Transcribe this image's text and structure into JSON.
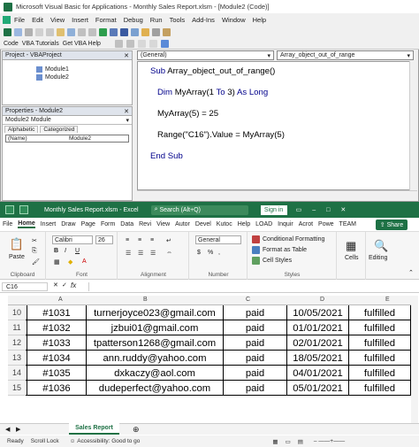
{
  "vba": {
    "title": "Microsoft Visual Basic for Applications - Monthly Sales Report.xlsm - [Module2 (Code)]",
    "menu": [
      "File",
      "Edit",
      "View",
      "Insert",
      "Format",
      "Debug",
      "Run",
      "Tools",
      "Add-Ins",
      "Window",
      "Help"
    ],
    "toolbar": {
      "code": "Code",
      "vba_tutorials": "VBA Tutorials",
      "get_help": "Get VBA Help"
    },
    "project_title": "Project - VBAProject",
    "tree": [
      "Module1",
      "Module2"
    ],
    "properties_title": "Properties - Module2",
    "object_name": "Module2",
    "object_type": "Module",
    "prop_tabs": [
      "Alphabetic",
      "Categorized"
    ],
    "prop_row": {
      "name": "(Name)",
      "value": "Module2"
    },
    "object_dropdown": "(General)",
    "proc_dropdown": "Array_object_out_of_range",
    "code": {
      "l1_kw": "Sub",
      "l1_rest": " Array_object_out_of_range()",
      "l2_kw1": "Dim",
      "l2_mid": " MyArray(1 ",
      "l2_kw2": "To",
      "l2_mid2": " 3) ",
      "l2_kw3": "As Long",
      "l3": "MyArray(5) = 25",
      "l4": "Range(\"C16\").Value = MyArray(5)",
      "l5": "End Sub"
    }
  },
  "excel": {
    "title": "Monthly Sales Report.xlsm  -  Excel",
    "search": "Search (Alt+Q)",
    "signin": "Sign in",
    "tabs": [
      "File",
      "Home",
      "Insert",
      "Draw",
      "Page",
      "Form",
      "Data",
      "Revi",
      "View",
      "Autor",
      "Devel",
      "Kutoc",
      "Help",
      "LOAD",
      "Inquir",
      "Acrot",
      "Powe",
      "TEAM"
    ],
    "share": "Share",
    "font_name": "Calibri",
    "font_size": "26",
    "number_format": "General",
    "ribbon": {
      "paste": "Paste",
      "clipboard": "Clipboard",
      "font": "Font",
      "alignment": "Alignment",
      "number": "Number",
      "styles": "Styles",
      "conditional": "Conditional Formatting",
      "format_table": "Format as Table",
      "cell_styles": "Cell Styles",
      "cells": "Cells",
      "editing": "Editing"
    },
    "name_box": "C16",
    "fx": "fx",
    "columns": [
      "A",
      "B",
      "C",
      "D",
      "E"
    ],
    "rows": [
      {
        "num": "10",
        "id": "#1031",
        "email": "turnerjoyce023@gmail.com",
        "status": "paid",
        "date": "10/05/2021",
        "fulfil": "fulfilled"
      },
      {
        "num": "11",
        "id": "#1032",
        "email": "jzbui01@gmail.com",
        "status": "paid",
        "date": "01/01/2021",
        "fulfil": "fulfilled"
      },
      {
        "num": "12",
        "id": "#1033",
        "email": "tpatterson1268@gmail.com",
        "status": "paid",
        "date": "02/01/2021",
        "fulfil": "fulfilled"
      },
      {
        "num": "13",
        "id": "#1034",
        "email": "ann.ruddy@yahoo.com",
        "status": "paid",
        "date": "18/05/2021",
        "fulfil": "fulfilled"
      },
      {
        "num": "14",
        "id": "#1035",
        "email": "dxkaczy@aol.com",
        "status": "paid",
        "date": "04/01/2021",
        "fulfil": "fulfilled"
      },
      {
        "num": "15",
        "id": "#1036",
        "email": "dudeperfect@yahoo.com",
        "status": "paid",
        "date": "05/01/2021",
        "fulfil": "fulfilled"
      }
    ],
    "sheet_tab": "Sales Report",
    "status": [
      "Ready",
      "Scroll Lock",
      "Accessibility: Good to go"
    ]
  },
  "colors": {
    "excel_green": "#1e7145",
    "vba_keyword": "#00008b"
  }
}
